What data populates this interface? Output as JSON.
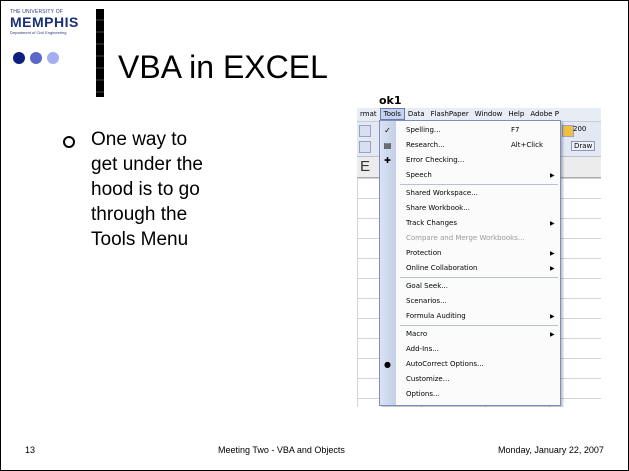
{
  "logo": {
    "tagline_top": "THE UNIVERSITY OF",
    "name": "MEMPHIS",
    "tagline_bottom": "Department of Civil Engineering"
  },
  "title": "VBA in EXCEL",
  "bullet": {
    "lines": [
      "One way to",
      "get under the",
      "hood is to go",
      "through the",
      "Tools Menu"
    ]
  },
  "screenshot": {
    "window_title": "ok1",
    "menubar": [
      "rmat",
      "Tools",
      "Data",
      "FlashPaper",
      "Window",
      "Help",
      "Adobe P"
    ],
    "toolbar_zoom": "200",
    "toolbar_draw": "Draw",
    "column_header": "E",
    "tools_menu": [
      {
        "label": "Spelling...",
        "shortcut": "F7",
        "icon": "spelling-icon",
        "icon_glyph": "✓"
      },
      {
        "label": "Research...",
        "shortcut": "Alt+Click",
        "icon": "research-icon",
        "icon_glyph": "▤"
      },
      {
        "label": "Error Checking...",
        "icon": "error-checking-icon",
        "icon_glyph": "✚"
      },
      {
        "label": "Speech",
        "submenu": true
      },
      {
        "sep": true
      },
      {
        "label": "Shared Workspace..."
      },
      {
        "label": "Share Workbook..."
      },
      {
        "label": "Track Changes",
        "submenu": true
      },
      {
        "label": "Compare and Merge Workbooks...",
        "disabled": true
      },
      {
        "label": "Protection",
        "submenu": true
      },
      {
        "label": "Online Collaboration",
        "submenu": true
      },
      {
        "sep": true
      },
      {
        "label": "Goal Seek..."
      },
      {
        "label": "Scenarios..."
      },
      {
        "label": "Formula Auditing",
        "submenu": true
      },
      {
        "sep": true
      },
      {
        "label": "Macro",
        "submenu": true
      },
      {
        "label": "Add-Ins..."
      },
      {
        "label": "AutoCorrect Options...",
        "icon": "autocorrect-icon",
        "icon_glyph": "●"
      },
      {
        "label": "Customize..."
      },
      {
        "label": "Options..."
      }
    ]
  },
  "footer": {
    "slide_number": "13",
    "center": "Meeting Two - VBA and Objects",
    "date": "Monday, January 22, 2007"
  },
  "colors": {
    "dot1": "#0e1f80",
    "dot2": "#5b68c8",
    "dot3": "#a3aef0",
    "logo_blue": "#1a2f7a"
  }
}
